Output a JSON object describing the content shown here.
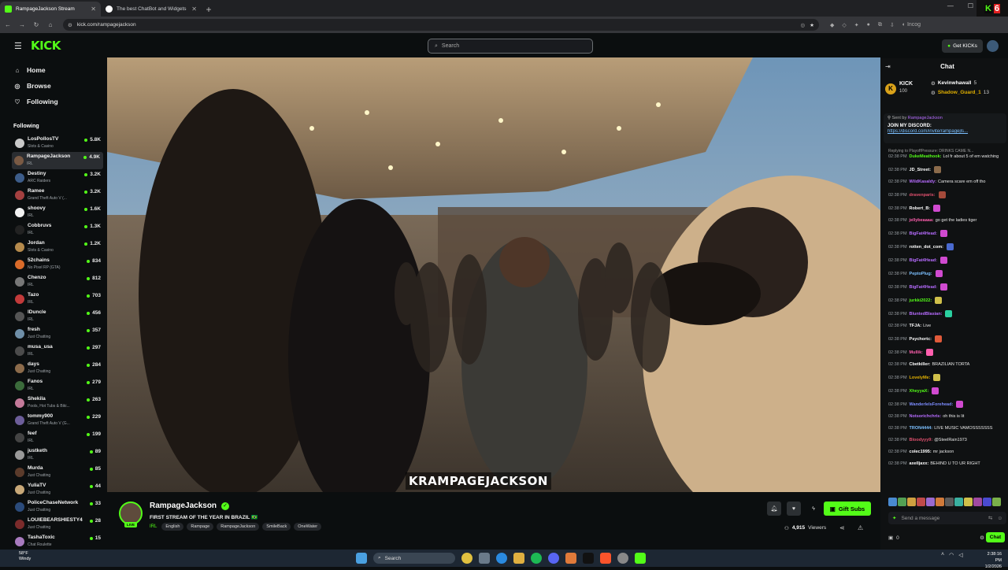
{
  "browser": {
    "tabs": [
      {
        "title": "RampageJackson Stream",
        "active": true,
        "favicon_color": "#53fc18"
      },
      {
        "title": "The best ChatBot and Widgets",
        "active": false,
        "favicon_color": "#ffffff"
      }
    ],
    "url": "kick.com/rampagejackson",
    "incognito_label": "Incog"
  },
  "header": {
    "logo": "KICK",
    "search_placeholder": "Search",
    "get_kicks_label": "Get KICKs"
  },
  "sidebar": {
    "nav": [
      {
        "label": "Home",
        "icon": "home-icon"
      },
      {
        "label": "Browse",
        "icon": "compass-icon"
      },
      {
        "label": "Following",
        "icon": "heart-icon"
      }
    ],
    "following_heading": "Following",
    "channels": [
      {
        "name": "LosPollosTV",
        "category": "Slots & Casino",
        "viewers": "5.8K",
        "color": "#c9c9c9"
      },
      {
        "name": "RampageJackson",
        "category": "IRL",
        "viewers": "4.9K",
        "color": "#7a5a44",
        "selected": true
      },
      {
        "name": "Destiny",
        "category": "ARC Raiders",
        "viewers": "3.2K",
        "color": "#3d5d8a"
      },
      {
        "name": "Ramee",
        "category": "Grand Theft Auto V (...",
        "viewers": "3.2K",
        "color": "#a44040"
      },
      {
        "name": "shoovy",
        "category": "IRL",
        "viewers": "1.6K",
        "color": "#f2f2f2"
      },
      {
        "name": "Cobbruvs",
        "category": "IRL",
        "viewers": "1.3K",
        "color": "#222222"
      },
      {
        "name": "Jordan",
        "category": "Slots & Casino",
        "viewers": "1.2K",
        "color": "#b58a4c"
      },
      {
        "name": "52chains",
        "category": "No Pixel RP (GTA)",
        "viewers": "834",
        "color": "#d96b2a"
      },
      {
        "name": "Chenzo",
        "category": "IRL",
        "viewers": "812",
        "color": "#777777"
      },
      {
        "name": "Tazo",
        "category": "IRL",
        "viewers": "703",
        "color": "#c23a3a"
      },
      {
        "name": "lDuncle",
        "category": "IRL",
        "viewers": "456",
        "color": "#555555"
      },
      {
        "name": "fresh",
        "category": "Just Chatting",
        "viewers": "357",
        "color": "#6f8fa8"
      },
      {
        "name": "musa_usa",
        "category": "IRL",
        "viewers": "297",
        "color": "#4b4b4b"
      },
      {
        "name": "days",
        "category": "Just Chatting",
        "viewers": "284",
        "color": "#8c6b4b"
      },
      {
        "name": "Fanos",
        "category": "IRL",
        "viewers": "279",
        "color": "#3b6b3b"
      },
      {
        "name": "Shekila",
        "category": "Pools, Hot Tubs & Biki...",
        "viewers": "263",
        "color": "#c47a9a"
      },
      {
        "name": "tommy900",
        "category": "Grand Theft Auto V (G...",
        "viewers": "229",
        "color": "#6d5e9a"
      },
      {
        "name": "feef",
        "category": "IRL",
        "viewers": "199",
        "color": "#444444"
      },
      {
        "name": "justketh",
        "category": "IRL",
        "viewers": "89",
        "color": "#9a9a9a"
      },
      {
        "name": "Murda",
        "category": "Just Chatting",
        "viewers": "85",
        "color": "#5b3b2b"
      },
      {
        "name": "YuliaTV",
        "category": "Just Chatting",
        "viewers": "44",
        "color": "#c8a878"
      },
      {
        "name": "PoliceChaseNetwork",
        "category": "Just Chatting",
        "viewers": "33",
        "color": "#2b4b7b"
      },
      {
        "name": "LOUIEBEARSHIESTY4",
        "category": "Just Chatting",
        "viewers": "28",
        "color": "#7b2b2b"
      },
      {
        "name": "TashaToxic",
        "category": "Chat Roulette",
        "viewers": "15",
        "color": "#a87bbf"
      }
    ]
  },
  "player": {
    "caption": "KRAMPAGEJACKSON"
  },
  "stream_info": {
    "streamer": "RampageJackson",
    "live_badge": "LIVE",
    "title": "FIRST STREAM OF THE YEAR IN BRAZIL 🇧🇷",
    "category": "IRL",
    "tags": [
      "English",
      "Rampage",
      "RampageJackson",
      "SmileBack",
      "OneWater"
    ],
    "gift_subs_label": "Gift Subs",
    "viewers_count": "4,915",
    "viewers_label": "Viewers"
  },
  "chat": {
    "title": "Chat",
    "leaderboard": {
      "kick_label": "KICK",
      "kick_count": "100",
      "users": [
        {
          "name": "Kevinwhawall",
          "count": "5",
          "color": "#ffffff"
        },
        {
          "name": "Shadow_Guard_1",
          "count": "13",
          "color": "#e2b100"
        }
      ]
    },
    "pinned": {
      "sent_by_label": "Sent by",
      "sent_by_user": "RampageJackson",
      "message": "JOIN MY DISCORD:",
      "link": "https://discord.com/invite/rampagejls..."
    },
    "reply_note": "Replying to PlayoffPressure: DRINKS CAME N...",
    "messages": [
      {
        "time": "02:38 PM",
        "user": "DukeMeathook:",
        "color": "#53fc18",
        "text": "Lol fr about 5 of em watching"
      },
      {
        "time": "02:38 PM",
        "user": "JD_Street:",
        "color": "#ffffff",
        "text": "",
        "emote": "#8b6b4b"
      },
      {
        "time": "02:38 PM",
        "user": "WildKasaldy:",
        "color": "#b76cff",
        "text": "Camera scare em off tho"
      },
      {
        "time": "02:38 PM",
        "user": "dravenparis:",
        "color": "#e0506e",
        "text": "",
        "emote": "#a44a3a"
      },
      {
        "time": "02:38 PM",
        "user": "Robert_B:",
        "color": "#ffffff",
        "text": "",
        "emote": "#d04ad0"
      },
      {
        "time": "02:38 PM",
        "user": "jellybeaaaa:",
        "color": "#ff5fae",
        "text": "go get the ladies tiger"
      },
      {
        "time": "02:38 PM",
        "user": "BigFat4Head:",
        "color": "#b76cff",
        "text": "",
        "emote": "#d04ad0"
      },
      {
        "time": "02:38 PM",
        "user": "rotten_dot_com:",
        "color": "#ffffff",
        "text": "",
        "emote": "#4a6ad0"
      },
      {
        "time": "02:38 PM",
        "user": "BigFat4Head:",
        "color": "#b76cff",
        "text": "",
        "emote": "#d04ad0"
      },
      {
        "time": "02:38 PM",
        "user": "PeptoPlug:",
        "color": "#7cc0ff",
        "text": "",
        "emote": "#d04ad0"
      },
      {
        "time": "02:38 PM",
        "user": "BigFat4Head:",
        "color": "#b76cff",
        "text": "",
        "emote": "#d04ad0"
      },
      {
        "time": "02:38 PM",
        "user": "jurkki2022:",
        "color": "#53fc18",
        "text": "",
        "emote": "#d0c04a"
      },
      {
        "time": "02:38 PM",
        "user": "BluntedBlasian:",
        "color": "#b76cff",
        "text": "",
        "emote": "#2ad0a0"
      },
      {
        "time": "02:38 PM",
        "user": "TFJA:",
        "color": "#ffffff",
        "text": "Live"
      },
      {
        "time": "02:38 PM",
        "user": "Psychortc:",
        "color": "#ffffff",
        "text": "",
        "emote": "#e05a3a"
      },
      {
        "time": "02:38 PM",
        "user": "Mullik:",
        "color": "#ff5fae",
        "text": "",
        "emote": "#ff5fae"
      },
      {
        "time": "02:38 PM",
        "user": "Cbetkiller:",
        "color": "#ffffff",
        "text": "BRAZILIAN TORTA"
      },
      {
        "time": "02:38 PM",
        "user": "LovelyMe:",
        "color": "#e2b100",
        "text": "",
        "emote": "#d0c04a"
      },
      {
        "time": "02:38 PM",
        "user": "XheyyaX:",
        "color": "#53fc18",
        "text": "",
        "emote": "#d04ad0"
      },
      {
        "time": "02:38 PM",
        "user": "WanderlelsForehead:",
        "color": "#7c8cff",
        "text": "",
        "emote": "#d04ad0"
      },
      {
        "time": "02:38 PM",
        "user": "Notsorichchris:",
        "color": "#b76cff",
        "text": "oh this is lit"
      },
      {
        "time": "02:38 PM",
        "user": "TRON4444:",
        "color": "#7cc0ff",
        "text": "LIVE MUSIC VAMOSSSSSSS"
      },
      {
        "time": "02:38 PM",
        "user": "Bloodyyy9:",
        "color": "#e0506e",
        "text": "@SteelRain1973"
      },
      {
        "time": "02:38 PM",
        "user": "colec1995:",
        "color": "#ffffff",
        "text": "mr jackson"
      },
      {
        "time": "02:38 PM",
        "user": "axelljaxx:",
        "color": "#ffffff",
        "text": "BEHIND U TO UR RIGHT"
      }
    ],
    "input_placeholder": "Send a message",
    "points": "0",
    "send_label": "Chat"
  },
  "taskbar": {
    "temp": "58°F",
    "weather": "Windy",
    "search_label": "Search",
    "time": "2:38:16 PM",
    "date": "1/2/2026"
  }
}
